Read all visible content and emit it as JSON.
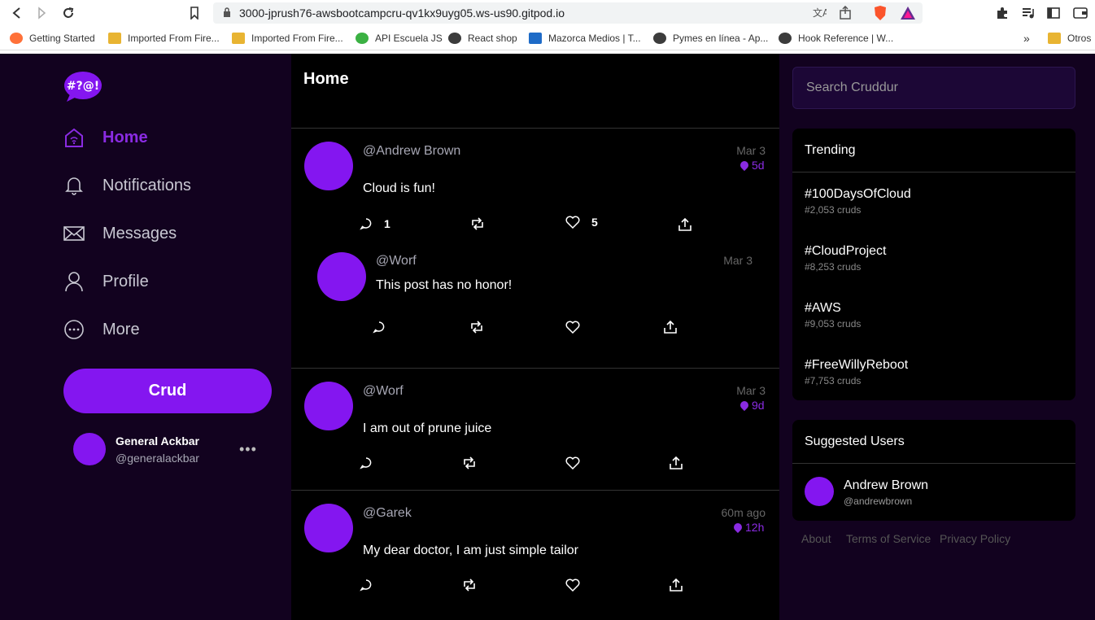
{
  "browser": {
    "url": "3000-jprush76-awsbootcampcru-qv1kx9uyg05.ws-us90.gitpod.io",
    "bookmarks": [
      {
        "label": "Getting Started"
      },
      {
        "label": "Imported From Fire..."
      },
      {
        "label": "Imported From Fire..."
      },
      {
        "label": "API Escuela JS"
      },
      {
        "label": "React shop"
      },
      {
        "label": "Mazorca Medios | T..."
      },
      {
        "label": "Pymes en línea - Ap..."
      },
      {
        "label": "Hook Reference | W..."
      }
    ],
    "overflow": "»",
    "other_folder": "Otros"
  },
  "sidebar": {
    "logo_text": "#?@!",
    "items": [
      {
        "label": "Home",
        "icon": "home-icon",
        "active": true
      },
      {
        "label": "Notifications",
        "icon": "bell-icon"
      },
      {
        "label": "Messages",
        "icon": "envelope-icon"
      },
      {
        "label": "Profile",
        "icon": "user-icon"
      },
      {
        "label": "More",
        "icon": "more-icon"
      }
    ],
    "crud_label": "Crud",
    "user": {
      "name": "General Ackbar",
      "handle": "@generalackbar"
    }
  },
  "feed": {
    "title": "Home",
    "posts": [
      {
        "handle": "@Andrew Brown",
        "date": "Mar 3",
        "expires": "5d",
        "message": "Cloud is fun!",
        "replies": "1",
        "likes": "5"
      },
      {
        "handle": "@Worf",
        "date": "Mar 3",
        "message": "This post has no honor!"
      },
      {
        "handle": "@Worf",
        "date": "Mar 3",
        "expires": "9d",
        "message": "I am out of prune juice"
      },
      {
        "handle": "@Garek",
        "date": "60m ago",
        "expires": "12h",
        "message": "My dear doctor, I am just simple tailor"
      }
    ]
  },
  "right": {
    "search_placeholder": "Search Cruddur",
    "trending_title": "Trending",
    "trends": [
      {
        "name": "#100DaysOfCloud",
        "count": "#2,053 cruds"
      },
      {
        "name": "#CloudProject",
        "count": "#8,253 cruds"
      },
      {
        "name": "#AWS",
        "count": "#9,053 cruds"
      },
      {
        "name": "#FreeWillyReboot",
        "count": "#7,753 cruds"
      }
    ],
    "suggested_title": "Suggested Users",
    "suggested": [
      {
        "name": "Andrew Brown",
        "handle": "@andrewbrown"
      }
    ],
    "footer": [
      "About",
      "Terms of Service",
      "Privacy Policy"
    ]
  },
  "colors": {
    "accent": "#8416f0",
    "sidebar_bg": "#12021f",
    "feed_bg": "#000000"
  }
}
